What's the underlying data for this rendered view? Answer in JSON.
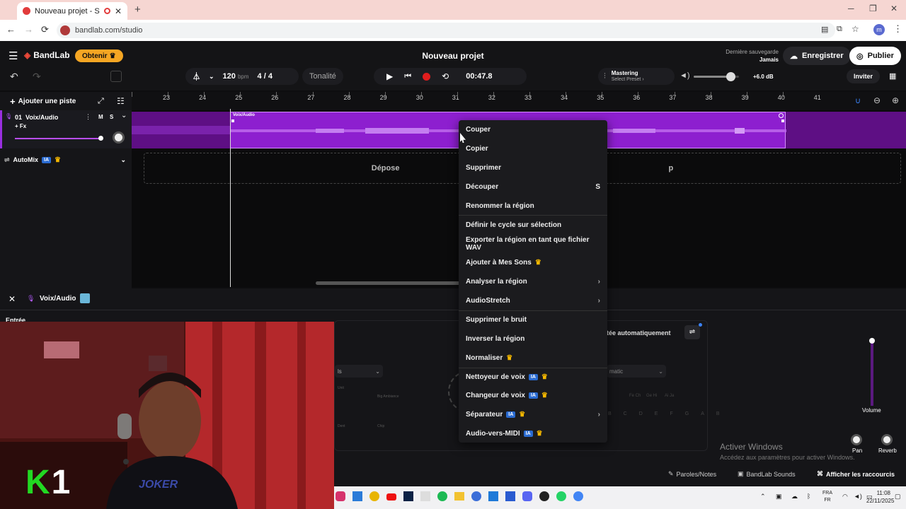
{
  "browser": {
    "tab_title": "Nouveau projet - Studio",
    "url": "bandlab.com/studio",
    "profile": "m"
  },
  "header": {
    "brand": "BandLab",
    "get_label": "Obtenir",
    "project_title": "Nouveau projet",
    "last_save_label": "Dernière sauvegarde",
    "last_save_value": "Jamais",
    "save_button": "Enregistrer",
    "publish_button": "Publier",
    "invite_button": "Inviter"
  },
  "transport": {
    "tempo": "120",
    "tempo_unit": "bpm",
    "sig_num": "4",
    "sig_sep": "/",
    "sig_den": "4",
    "key_label": "Tonalité",
    "time": "00:47.8",
    "mastering_label": "Mastering",
    "mastering_preset": "Select Preset",
    "volume_db": "+6.0 dB",
    "volume_level": 0.82
  },
  "tracks": {
    "add_track": "Ajouter une piste",
    "track_name": "01  Voix/Audio",
    "fx": "+ Fx",
    "mute": "M",
    "solo": "S",
    "automix": "AutoMix",
    "ia_badge": "IA"
  },
  "ruler": [
    "23",
    "24",
    "25",
    "26",
    "27",
    "28",
    "29",
    "30",
    "31",
    "32",
    "33",
    "34",
    "35",
    "36",
    "37",
    "38",
    "39",
    "40",
    "41"
  ],
  "clip_label": "Voix/Audio",
  "dropzone_left": "Dépose",
  "dropzone_right": "p",
  "context_menu": [
    {
      "label": "Couper"
    },
    {
      "label": "Copier"
    },
    {
      "label": "Supprimer"
    },
    {
      "label": "Découper",
      "shortcut": "S"
    },
    {
      "label": "Renommer la région"
    },
    {
      "label": "Définir le cycle sur sélection"
    },
    {
      "label": "Exporter la région en tant que fichier WAV"
    },
    {
      "label": "Ajouter à Mes Sons",
      "crown": true
    },
    {
      "label": "Analyser la région",
      "submenu": true
    },
    {
      "label": "AudioStretch",
      "submenu": true
    },
    {
      "label": "Supprimer le bruit"
    },
    {
      "label": "Inverser la région"
    },
    {
      "label": "Normaliser",
      "crown": true
    },
    {
      "label": "Nettoyeur de voix",
      "ia": true,
      "crown": true
    },
    {
      "label": "Changeur de voix",
      "ia": true,
      "crown": true
    },
    {
      "label": "Séparateur",
      "ia": true,
      "crown": true,
      "submenu": true
    },
    {
      "label": "Audio-vers-MIDI",
      "ia": true,
      "crown": true
    }
  ],
  "panel": {
    "title": "Voix/Audio",
    "input_label": "Entrée",
    "auto_label": "tée automatiquement",
    "preset_partial": "matic",
    "select_partial": "ls",
    "volume_label": "Volume",
    "pan_label": "Pan",
    "reverb_label": "Reverb",
    "fx_small": [
      "Fe Ch",
      "Ge Hi",
      "Ai Ja"
    ],
    "fx_row": [
      "B",
      "C",
      "D",
      "E",
      "F",
      "G",
      "A",
      "B"
    ],
    "fx_buttons": [
      "Unit",
      "Big Ambiance",
      "Dent",
      "Chip"
    ],
    "lyrics_button": "Paroles/Notes",
    "sounds_button": "BandLab Sounds",
    "shortcuts_button": "Afficher les raccourcis"
  },
  "windows": {
    "activate_title": "Activer Windows",
    "activate_sub": "Accédez aux paramètres pour activer Windows.",
    "lang1": "FRA",
    "lang2": "FR",
    "clock": "11:08",
    "date": "22/11/2025"
  },
  "webcam": {
    "overlay": "K1",
    "shirt_text": "JOKER"
  },
  "colors": {
    "accent_orange": "#f5a623",
    "clip_purple": "#8d1fcf",
    "lane_purple": "#5e0f84",
    "record_red": "#e11d1d",
    "tab_bar": "#f6d6d2"
  }
}
